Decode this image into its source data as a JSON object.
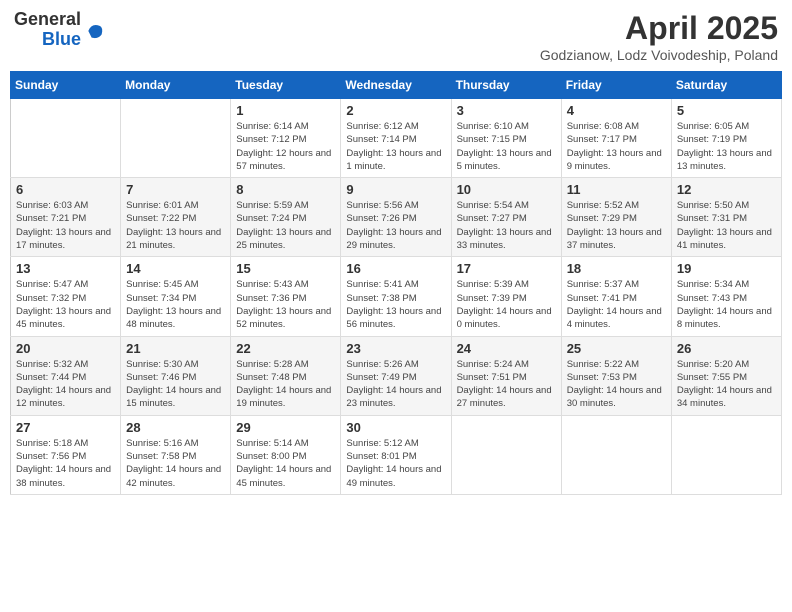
{
  "logo": {
    "general": "General",
    "blue": "Blue"
  },
  "title": {
    "month": "April 2025",
    "location": "Godzianow, Lodz Voivodeship, Poland"
  },
  "weekdays": [
    "Sunday",
    "Monday",
    "Tuesday",
    "Wednesday",
    "Thursday",
    "Friday",
    "Saturday"
  ],
  "weeks": [
    [
      {
        "day": "",
        "sunrise": "",
        "sunset": "",
        "daylight": ""
      },
      {
        "day": "",
        "sunrise": "",
        "sunset": "",
        "daylight": ""
      },
      {
        "day": "1",
        "sunrise": "Sunrise: 6:14 AM",
        "sunset": "Sunset: 7:12 PM",
        "daylight": "Daylight: 12 hours and 57 minutes."
      },
      {
        "day": "2",
        "sunrise": "Sunrise: 6:12 AM",
        "sunset": "Sunset: 7:14 PM",
        "daylight": "Daylight: 13 hours and 1 minute."
      },
      {
        "day": "3",
        "sunrise": "Sunrise: 6:10 AM",
        "sunset": "Sunset: 7:15 PM",
        "daylight": "Daylight: 13 hours and 5 minutes."
      },
      {
        "day": "4",
        "sunrise": "Sunrise: 6:08 AM",
        "sunset": "Sunset: 7:17 PM",
        "daylight": "Daylight: 13 hours and 9 minutes."
      },
      {
        "day": "5",
        "sunrise": "Sunrise: 6:05 AM",
        "sunset": "Sunset: 7:19 PM",
        "daylight": "Daylight: 13 hours and 13 minutes."
      }
    ],
    [
      {
        "day": "6",
        "sunrise": "Sunrise: 6:03 AM",
        "sunset": "Sunset: 7:21 PM",
        "daylight": "Daylight: 13 hours and 17 minutes."
      },
      {
        "day": "7",
        "sunrise": "Sunrise: 6:01 AM",
        "sunset": "Sunset: 7:22 PM",
        "daylight": "Daylight: 13 hours and 21 minutes."
      },
      {
        "day": "8",
        "sunrise": "Sunrise: 5:59 AM",
        "sunset": "Sunset: 7:24 PM",
        "daylight": "Daylight: 13 hours and 25 minutes."
      },
      {
        "day": "9",
        "sunrise": "Sunrise: 5:56 AM",
        "sunset": "Sunset: 7:26 PM",
        "daylight": "Daylight: 13 hours and 29 minutes."
      },
      {
        "day": "10",
        "sunrise": "Sunrise: 5:54 AM",
        "sunset": "Sunset: 7:27 PM",
        "daylight": "Daylight: 13 hours and 33 minutes."
      },
      {
        "day": "11",
        "sunrise": "Sunrise: 5:52 AM",
        "sunset": "Sunset: 7:29 PM",
        "daylight": "Daylight: 13 hours and 37 minutes."
      },
      {
        "day": "12",
        "sunrise": "Sunrise: 5:50 AM",
        "sunset": "Sunset: 7:31 PM",
        "daylight": "Daylight: 13 hours and 41 minutes."
      }
    ],
    [
      {
        "day": "13",
        "sunrise": "Sunrise: 5:47 AM",
        "sunset": "Sunset: 7:32 PM",
        "daylight": "Daylight: 13 hours and 45 minutes."
      },
      {
        "day": "14",
        "sunrise": "Sunrise: 5:45 AM",
        "sunset": "Sunset: 7:34 PM",
        "daylight": "Daylight: 13 hours and 48 minutes."
      },
      {
        "day": "15",
        "sunrise": "Sunrise: 5:43 AM",
        "sunset": "Sunset: 7:36 PM",
        "daylight": "Daylight: 13 hours and 52 minutes."
      },
      {
        "day": "16",
        "sunrise": "Sunrise: 5:41 AM",
        "sunset": "Sunset: 7:38 PM",
        "daylight": "Daylight: 13 hours and 56 minutes."
      },
      {
        "day": "17",
        "sunrise": "Sunrise: 5:39 AM",
        "sunset": "Sunset: 7:39 PM",
        "daylight": "Daylight: 14 hours and 0 minutes."
      },
      {
        "day": "18",
        "sunrise": "Sunrise: 5:37 AM",
        "sunset": "Sunset: 7:41 PM",
        "daylight": "Daylight: 14 hours and 4 minutes."
      },
      {
        "day": "19",
        "sunrise": "Sunrise: 5:34 AM",
        "sunset": "Sunset: 7:43 PM",
        "daylight": "Daylight: 14 hours and 8 minutes."
      }
    ],
    [
      {
        "day": "20",
        "sunrise": "Sunrise: 5:32 AM",
        "sunset": "Sunset: 7:44 PM",
        "daylight": "Daylight: 14 hours and 12 minutes."
      },
      {
        "day": "21",
        "sunrise": "Sunrise: 5:30 AM",
        "sunset": "Sunset: 7:46 PM",
        "daylight": "Daylight: 14 hours and 15 minutes."
      },
      {
        "day": "22",
        "sunrise": "Sunrise: 5:28 AM",
        "sunset": "Sunset: 7:48 PM",
        "daylight": "Daylight: 14 hours and 19 minutes."
      },
      {
        "day": "23",
        "sunrise": "Sunrise: 5:26 AM",
        "sunset": "Sunset: 7:49 PM",
        "daylight": "Daylight: 14 hours and 23 minutes."
      },
      {
        "day": "24",
        "sunrise": "Sunrise: 5:24 AM",
        "sunset": "Sunset: 7:51 PM",
        "daylight": "Daylight: 14 hours and 27 minutes."
      },
      {
        "day": "25",
        "sunrise": "Sunrise: 5:22 AM",
        "sunset": "Sunset: 7:53 PM",
        "daylight": "Daylight: 14 hours and 30 minutes."
      },
      {
        "day": "26",
        "sunrise": "Sunrise: 5:20 AM",
        "sunset": "Sunset: 7:55 PM",
        "daylight": "Daylight: 14 hours and 34 minutes."
      }
    ],
    [
      {
        "day": "27",
        "sunrise": "Sunrise: 5:18 AM",
        "sunset": "Sunset: 7:56 PM",
        "daylight": "Daylight: 14 hours and 38 minutes."
      },
      {
        "day": "28",
        "sunrise": "Sunrise: 5:16 AM",
        "sunset": "Sunset: 7:58 PM",
        "daylight": "Daylight: 14 hours and 42 minutes."
      },
      {
        "day": "29",
        "sunrise": "Sunrise: 5:14 AM",
        "sunset": "Sunset: 8:00 PM",
        "daylight": "Daylight: 14 hours and 45 minutes."
      },
      {
        "day": "30",
        "sunrise": "Sunrise: 5:12 AM",
        "sunset": "Sunset: 8:01 PM",
        "daylight": "Daylight: 14 hours and 49 minutes."
      },
      {
        "day": "",
        "sunrise": "",
        "sunset": "",
        "daylight": ""
      },
      {
        "day": "",
        "sunrise": "",
        "sunset": "",
        "daylight": ""
      },
      {
        "day": "",
        "sunrise": "",
        "sunset": "",
        "daylight": ""
      }
    ]
  ]
}
